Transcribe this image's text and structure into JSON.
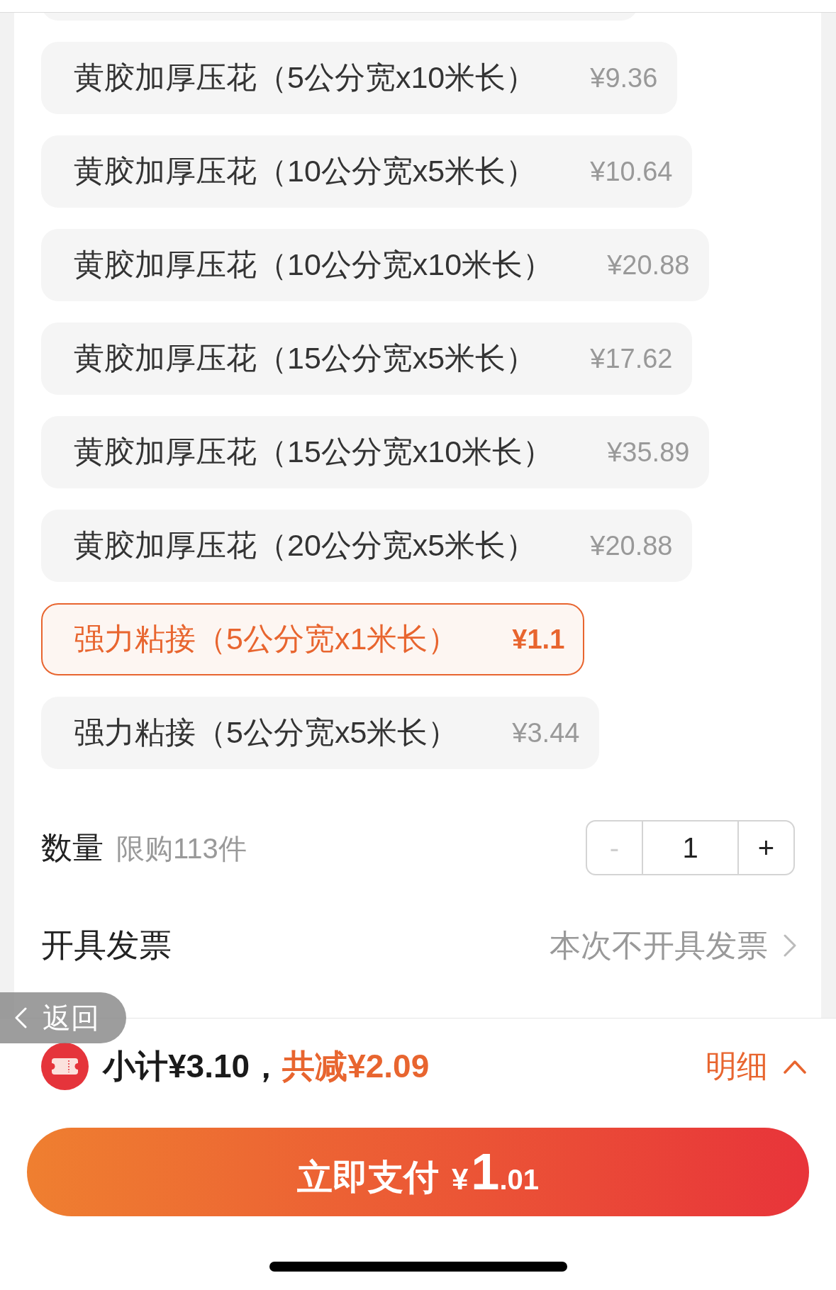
{
  "options": [
    {
      "name": "黄胶加厚压花（5公分宽x10米长）",
      "price": "¥9.36",
      "selected": false
    },
    {
      "name": "黄胶加厚压花（10公分宽x5米长）",
      "price": "¥10.64",
      "selected": false
    },
    {
      "name": "黄胶加厚压花（10公分宽x10米长）",
      "price": "¥20.88",
      "selected": false
    },
    {
      "name": "黄胶加厚压花（15公分宽x5米长）",
      "price": "¥17.62",
      "selected": false
    },
    {
      "name": "黄胶加厚压花（15公分宽x10米长）",
      "price": "¥35.89",
      "selected": false
    },
    {
      "name": "黄胶加厚压花（20公分宽x5米长）",
      "price": "¥20.88",
      "selected": false
    },
    {
      "name": "强力粘接（5公分宽x1米长）",
      "price": "¥1.1",
      "selected": true
    },
    {
      "name": "强力粘接（5公分宽x5米长）",
      "price": "¥3.44",
      "selected": false
    }
  ],
  "quantity": {
    "label": "数量",
    "limit": "限购113件",
    "stepper": {
      "decrement": "-",
      "value": "1",
      "increment": "+",
      "decrement_disabled": true
    }
  },
  "invoice": {
    "label": "开具发票",
    "value": "本次不开具发票"
  },
  "back_button": {
    "label": "返回"
  },
  "summary": {
    "subtotal": "小计¥3.10，",
    "discount": "共减¥2.09",
    "details": "明细"
  },
  "pay_button": {
    "label": "立即支付",
    "currency": "¥",
    "amount_whole": "1",
    "amount_fraction": ".01"
  }
}
